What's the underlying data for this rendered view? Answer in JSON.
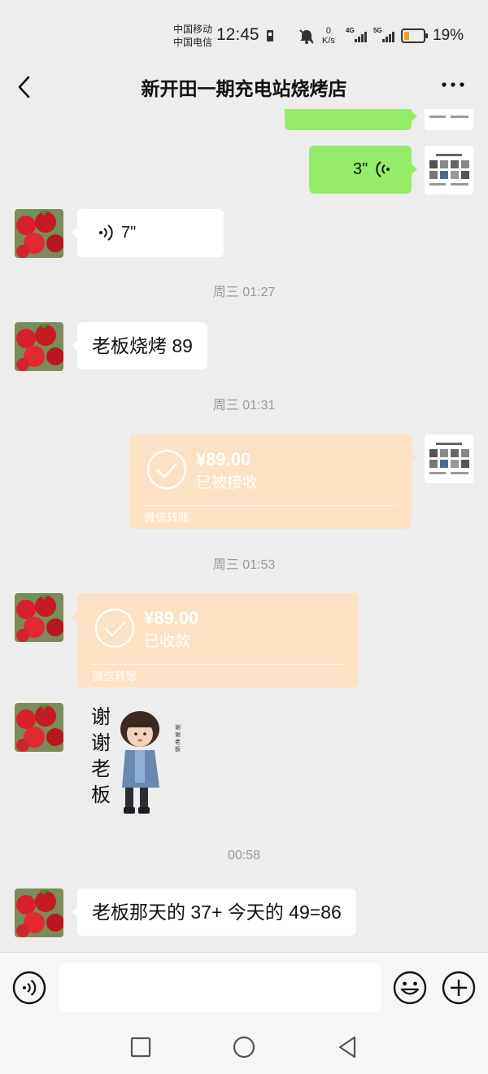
{
  "status_bar": {
    "carrier_1": "中国移动",
    "carrier_2": "中国电信",
    "time": "12:45",
    "net_speed_value": "0",
    "net_speed_unit": "K/s",
    "signal_1": "4G",
    "signal_2": "5G",
    "battery": "19%",
    "icons": [
      "mute-icon",
      "signal-icon",
      "battery-icon"
    ]
  },
  "header": {
    "title": "新开田一期充电站烧烤店",
    "icons": [
      "back-arrow-icon",
      "more-icon"
    ]
  },
  "messages": [
    {
      "type": "voice",
      "side": "right",
      "duration": "3\""
    },
    {
      "type": "voice",
      "side": "left",
      "duration": "7\""
    },
    {
      "type": "time",
      "text": "周三 01:27"
    },
    {
      "type": "text",
      "side": "left",
      "text": "老板烧烤 89"
    },
    {
      "type": "time",
      "text": "周三 01:31"
    },
    {
      "type": "transfer",
      "side": "right",
      "amount": "¥89.00",
      "status": "已被接收",
      "footer": "微信转账"
    },
    {
      "type": "time",
      "text": "周三 01:53"
    },
    {
      "type": "transfer",
      "side": "left",
      "amount": "¥89.00",
      "status": "已收款",
      "footer": "微信转账"
    },
    {
      "type": "sticker",
      "side": "left",
      "text": "谢谢老板",
      "side_caption": "谢谢老板"
    },
    {
      "type": "time",
      "text": "00:58"
    },
    {
      "type": "text",
      "side": "left",
      "text": "老板那天的 37+ 今天的 49=86"
    }
  ],
  "input_bar": {
    "placeholder": "",
    "icons": [
      "voice-input-icon",
      "emoji-icon",
      "plus-icon"
    ]
  },
  "nav_bar": {
    "icons": [
      "recent-apps-icon",
      "home-icon",
      "back-icon"
    ]
  },
  "colors": {
    "background": "#ededed",
    "my_bubble": "#95ec69",
    "their_bubble": "#ffffff",
    "transfer_bubble": "#fde1c4"
  }
}
